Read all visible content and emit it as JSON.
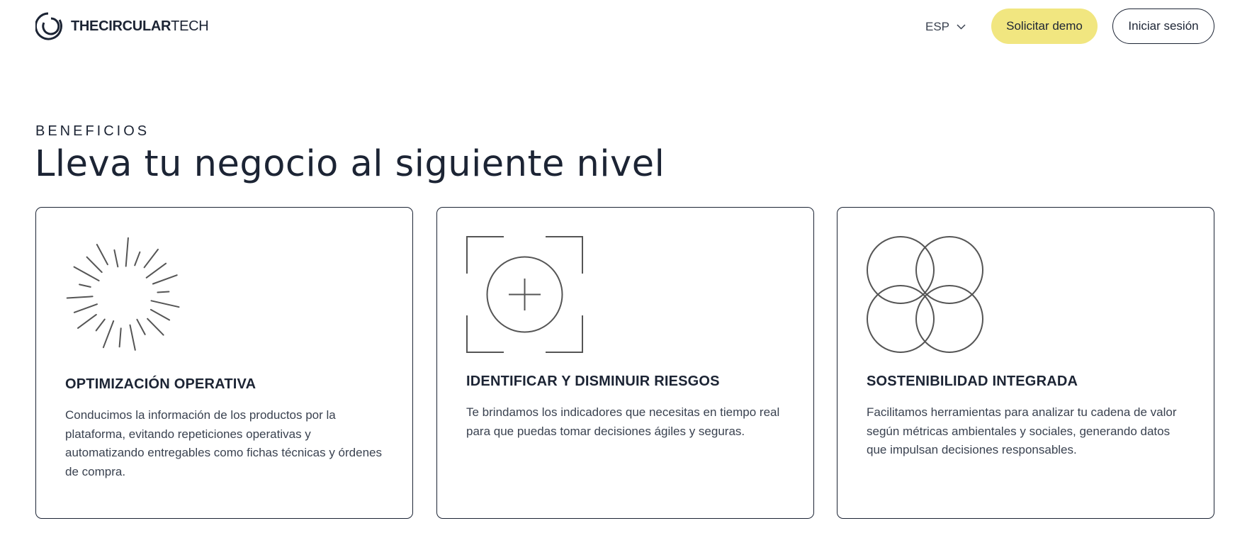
{
  "header": {
    "logo": {
      "part1": "THE",
      "part2": "CIRCULAR",
      "part3": "TECH"
    },
    "language": "ESP",
    "demo_button": "Solicitar demo",
    "login_button": "Iniciar sesión"
  },
  "section": {
    "eyebrow": "BENEFICIOS",
    "title": "Lleva tu negocio al siguiente nivel"
  },
  "cards": [
    {
      "icon": "radial-lines-icon",
      "title": "OPTIMIZACIÓN OPERATIVA",
      "text": "Conducimos la información de los productos por la plataforma, evitando repeticiones operativas y automatizando entregables como fichas técnicas y órdenes de compra."
    },
    {
      "icon": "target-plus-icon",
      "title": "IDENTIFICAR Y DISMINUIR RIESGOS",
      "text": "Te brindamos los indicadores que necesitas en tiempo real para que puedas tomar decisiones ágiles y seguras."
    },
    {
      "icon": "four-circles-icon",
      "title": "SOSTENIBILIDAD INTEGRADA",
      "text": "Facilitamos herramientas para analizar tu cadena de valor según métricas ambientales y sociales, generando datos que impulsan decisiones responsables."
    }
  ],
  "colors": {
    "text": "#1c2434",
    "accent": "#f1e680",
    "icon_stroke": "#555555"
  }
}
